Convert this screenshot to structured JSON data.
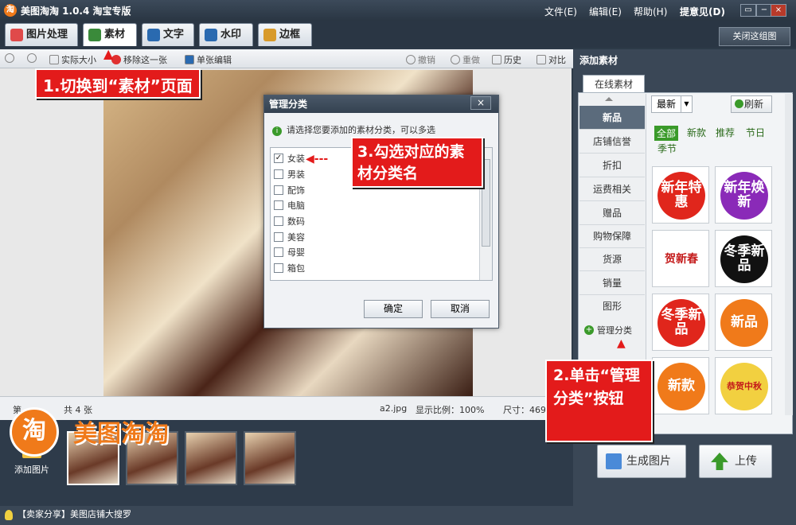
{
  "app": {
    "logo": "淘",
    "title": "美图淘淘 1.0.4 淘宝专版"
  },
  "menu": [
    "文件(E)",
    "编辑(E)",
    "帮助(H)",
    "提意见(D)"
  ],
  "window_controls": [
    "▭",
    "−",
    "□",
    "×"
  ],
  "tabs": [
    {
      "label": "图片处理",
      "color": "#e04a4a"
    },
    {
      "label": "素材",
      "color": "#3a8a3a"
    },
    {
      "label": "文字",
      "color": "#2a6ab0"
    },
    {
      "label": "水印",
      "color": "#2a6ab0"
    },
    {
      "label": "边框",
      "color": "#d89a2a"
    }
  ],
  "close_all": "关闭这组图",
  "toolbar": {
    "actual_size": "实际大小",
    "remove": "移除这一张",
    "single_edit": "单张编辑",
    "undo": "撤销",
    "redo": "重做",
    "history": "历史",
    "compare": "对比"
  },
  "status": {
    "count": "共 4 张",
    "file": "a2.jpg",
    "ratio": "显示比例：100%",
    "size": "尺寸：469",
    "prefix": "第"
  },
  "filmstrip": {
    "add_label": "添加图片"
  },
  "brand": {
    "circle": "淘",
    "name": "美图淘淘"
  },
  "bottombar": "【卖家分享】美图店铺大搜罗",
  "rightpanel": {
    "title": "添加素材",
    "tab": "在线素材",
    "categories": [
      "新品",
      "店铺信誉",
      "折扣",
      "运费相关",
      "赠品",
      "购物保障",
      "货源",
      "销量",
      "图形"
    ],
    "manage": "管理分类",
    "sort": "最新",
    "refresh": "刷新",
    "filters": [
      "全部",
      "新款",
      "推荐",
      "节日",
      "季节"
    ],
    "tiles": [
      {
        "text": "新年特惠",
        "color": "#e0261c"
      },
      {
        "text": "新年焕新",
        "color": "#8a2ab8"
      },
      {
        "text": "贺新春",
        "color": "#c41a1a"
      },
      {
        "text": "冬季新品",
        "color": "#111111"
      },
      {
        "text": "冬季新品",
        "color": "#e0261c"
      },
      {
        "text": "新品",
        "color": "#f07a1a"
      },
      {
        "text": "新款",
        "color": "#f07a1a"
      },
      {
        "text": "恭贺中秋",
        "color": "#f2d040"
      }
    ],
    "generate": "生成图片",
    "upload": "上传"
  },
  "dialog": {
    "title": "管理分类",
    "close": "×",
    "hint": "请选择您要添加的素材分类，可以多选",
    "options": [
      {
        "label": "女装",
        "checked": true
      },
      {
        "label": "男装",
        "checked": false
      },
      {
        "label": "配饰",
        "checked": false
      },
      {
        "label": "电脑",
        "checked": false
      },
      {
        "label": "数码",
        "checked": false
      },
      {
        "label": "美容",
        "checked": false
      },
      {
        "label": "母婴",
        "checked": false
      },
      {
        "label": "箱包",
        "checked": false
      }
    ],
    "ok": "确定",
    "cancel": "取消"
  },
  "callouts": {
    "c1": "1.切换到“素材”页面",
    "c2": "2.单击“管理分类”按钮",
    "c3": "3.勾选对应的素材分类名"
  }
}
